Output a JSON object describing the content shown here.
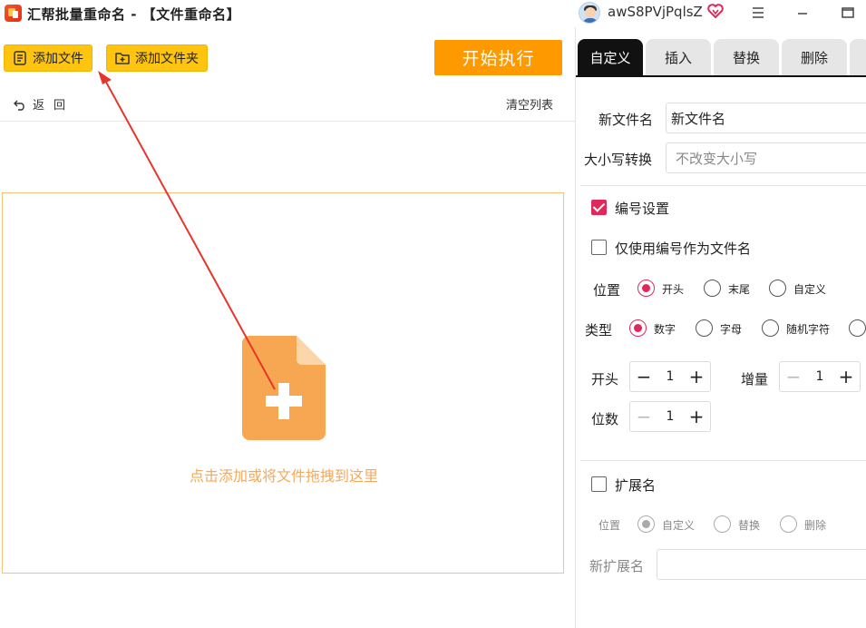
{
  "window": {
    "title": "汇帮批量重命名 - 【文件重命名】",
    "username": "awS8PVjPqlsZ"
  },
  "toolbar": {
    "add_file": "添加文件",
    "add_folder": "添加文件夹",
    "start": "开始执行"
  },
  "list": {
    "back": "返回",
    "clear": "清空列表",
    "drop_hint": "点击添加或将文件拖拽到这里"
  },
  "tabs": [
    {
      "label": "自定义",
      "active": true
    },
    {
      "label": "插入",
      "active": false
    },
    {
      "label": "替换",
      "active": false
    },
    {
      "label": "删除",
      "active": false
    }
  ],
  "settings": {
    "new_name_label": "新文件名",
    "new_name_value": "新文件名",
    "case_label": "大小写转换",
    "case_value": "不改变大小写",
    "numbering": {
      "label": "编号设置",
      "checked": true,
      "only_number_label": "仅使用编号作为文件名",
      "only_number_checked": false,
      "position_label": "位置",
      "position_options": [
        "开头",
        "末尾",
        "自定义"
      ],
      "position_selected": "开头",
      "type_label": "类型",
      "type_options": [
        "数字",
        "字母",
        "随机字符"
      ],
      "type_selected": "数字",
      "start_label": "开头",
      "start_value": "1",
      "increment_label": "增量",
      "increment_value": "1",
      "digits_label": "位数",
      "digits_value": "1"
    },
    "extension": {
      "label": "扩展名",
      "checked": false,
      "position_label": "位置",
      "options": [
        "自定义",
        "替换",
        "删除"
      ],
      "selected": "自定义",
      "new_ext_label": "新扩展名",
      "new_ext_value": ""
    }
  },
  "colors": {
    "accent_yellow": "#fec40f",
    "start_orange": "#fe9a00",
    "pink": "#e0285a",
    "file_icon": "#f7a752"
  }
}
